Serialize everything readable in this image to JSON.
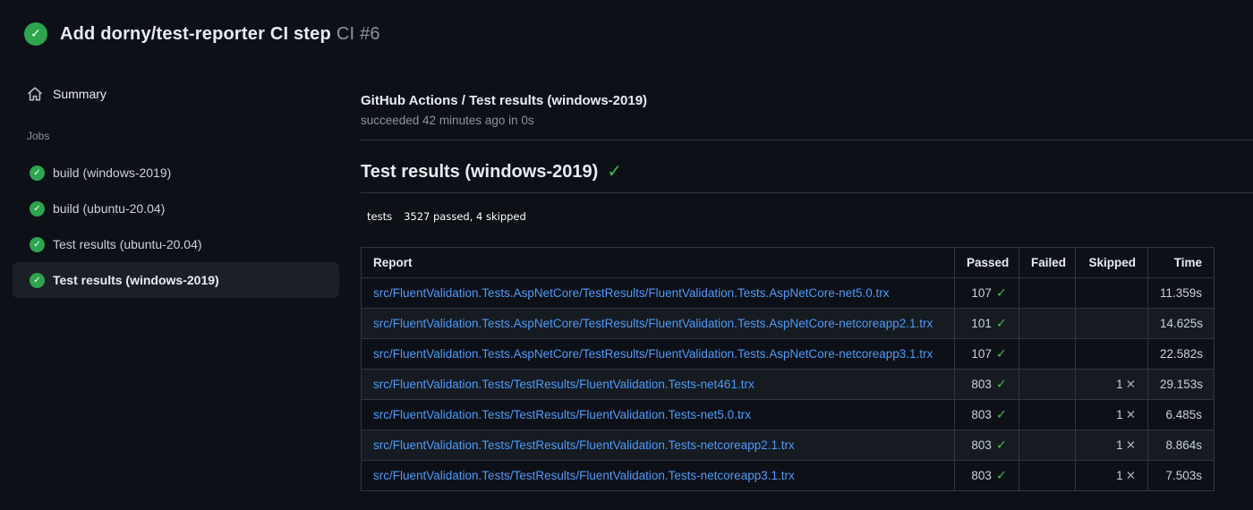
{
  "page": {
    "title": "Add dorny/test-reporter CI step",
    "run_number": "CI #6"
  },
  "icons": {
    "check_glyph": "✓",
    "cross_glyph": "✕"
  },
  "colors": {
    "background": "#0d1117",
    "row_alt": "#161b22",
    "border": "#30363d",
    "link": "#4e9af7",
    "success_circle": "#2ea44f",
    "success_check": "#3fb950",
    "badge_label_bg": "#555555",
    "badge_value_bg": "#44cc11"
  },
  "sidebar": {
    "summary_label": "Summary",
    "jobs_label": "Jobs",
    "jobs": [
      {
        "label": "build (windows-2019)",
        "selected": false
      },
      {
        "label": "build (ubuntu-20.04)",
        "selected": false
      },
      {
        "label": "Test results (ubuntu-20.04)",
        "selected": false
      },
      {
        "label": "Test results (windows-2019)",
        "selected": true
      }
    ]
  },
  "check": {
    "title": "GitHub Actions / Test results (windows-2019)",
    "status_line": "succeeded 42 minutes ago in 0s",
    "heading": "Test results (windows-2019)"
  },
  "badge": {
    "label": "tests",
    "value": "3527 passed, 4 skipped"
  },
  "table": {
    "headers": [
      "Report",
      "Passed",
      "Failed",
      "Skipped",
      "Time"
    ],
    "rows": [
      {
        "report": "src/FluentValidation.Tests.AspNetCore/TestResults/FluentValidation.Tests.AspNetCore-net5.0.trx",
        "passed": "107",
        "failed": "",
        "skipped": "",
        "time": "11.359s"
      },
      {
        "report": "src/FluentValidation.Tests.AspNetCore/TestResults/FluentValidation.Tests.AspNetCore-netcoreapp2.1.trx",
        "passed": "101",
        "failed": "",
        "skipped": "",
        "time": "14.625s"
      },
      {
        "report": "src/FluentValidation.Tests.AspNetCore/TestResults/FluentValidation.Tests.AspNetCore-netcoreapp3.1.trx",
        "passed": "107",
        "failed": "",
        "skipped": "",
        "time": "22.582s"
      },
      {
        "report": "src/FluentValidation.Tests/TestResults/FluentValidation.Tests-net461.trx",
        "passed": "803",
        "failed": "",
        "skipped": "1",
        "time": "29.153s"
      },
      {
        "report": "src/FluentValidation.Tests/TestResults/FluentValidation.Tests-net5.0.trx",
        "passed": "803",
        "failed": "",
        "skipped": "1",
        "time": "6.485s"
      },
      {
        "report": "src/FluentValidation.Tests/TestResults/FluentValidation.Tests-netcoreapp2.1.trx",
        "passed": "803",
        "failed": "",
        "skipped": "1",
        "time": "8.864s"
      },
      {
        "report": "src/FluentValidation.Tests/TestResults/FluentValidation.Tests-netcoreapp3.1.trx",
        "passed": "803",
        "failed": "",
        "skipped": "1",
        "time": "7.503s"
      }
    ]
  }
}
